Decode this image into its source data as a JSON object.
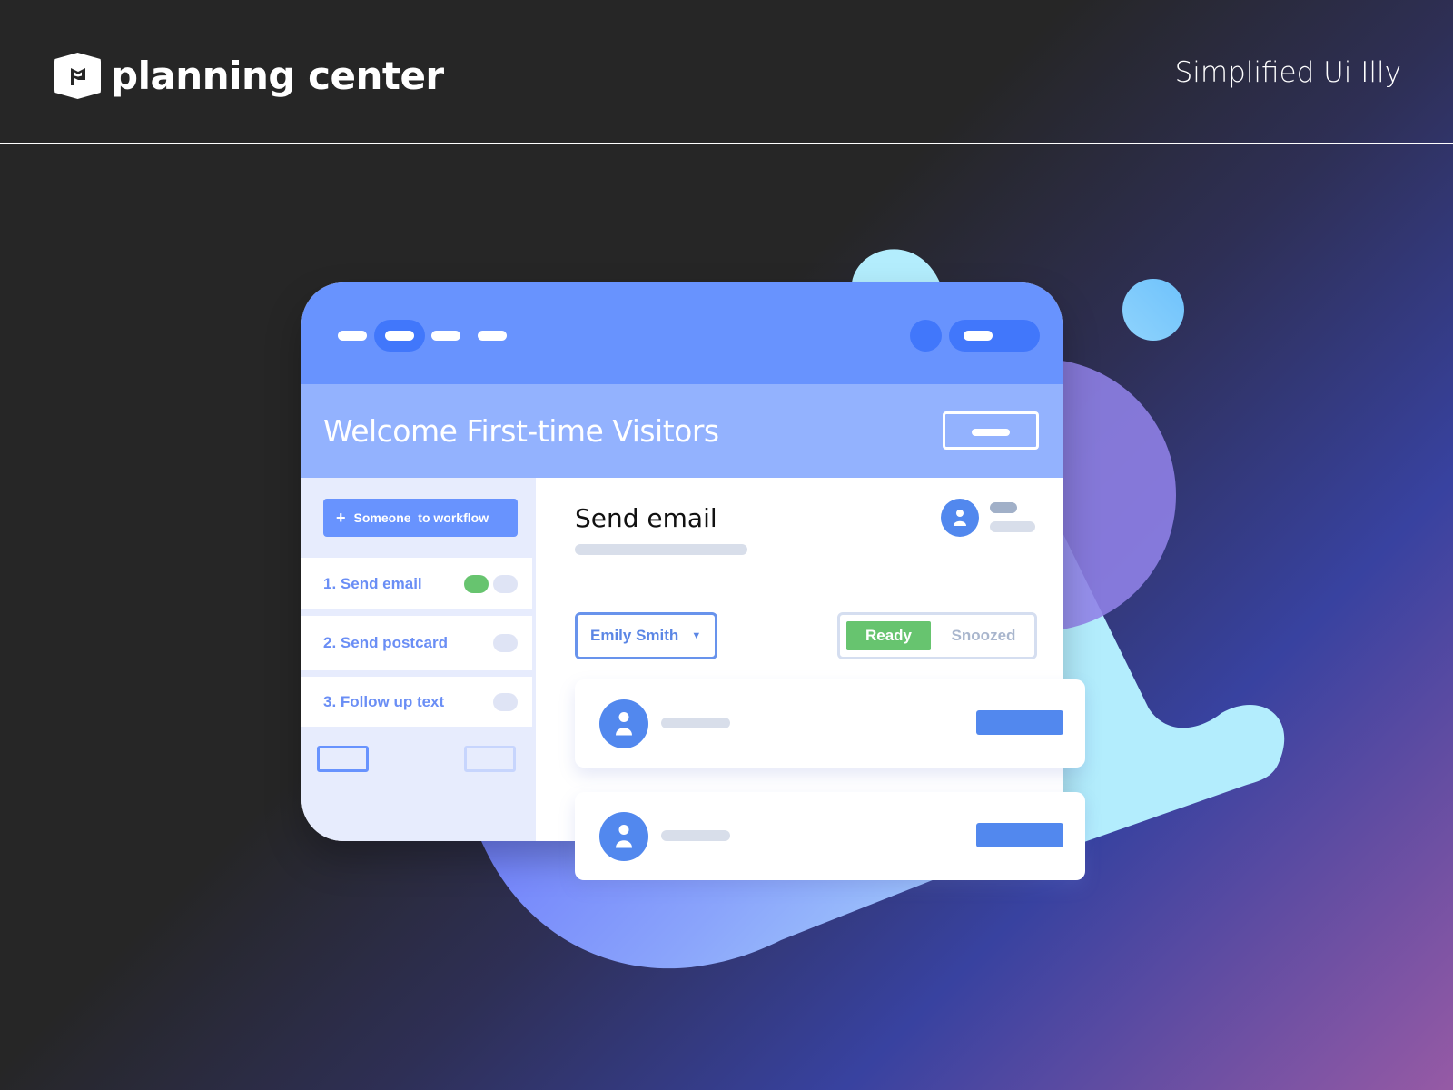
{
  "brand": {
    "name": "planning center",
    "logo_icon": "planning-center-flag-icon"
  },
  "page_label": "Simplified Ui Illy",
  "window": {
    "chrome": {
      "nav_items": 4,
      "active_nav_index": 1
    },
    "header": {
      "title": "Welcome First-time Visitors"
    },
    "sidebar": {
      "add_button_icon": "+",
      "add_button_label": "Someone  to workflow",
      "steps": [
        {
          "label": "1. Send email",
          "toggles": [
            "on",
            "off"
          ]
        },
        {
          "label": "2. Send postcard",
          "toggles": [
            "off"
          ]
        },
        {
          "label": "3. Follow up text",
          "toggles": [
            "off"
          ]
        }
      ]
    },
    "main": {
      "section_title": "Send email",
      "person_select": {
        "value": "Emily Smith",
        "caret": "▼"
      },
      "status_toggle": {
        "options": [
          "Ready",
          "Snoozed"
        ],
        "selected": "Ready"
      },
      "cards": [
        {
          "avatar_icon": "user-icon"
        },
        {
          "avatar_icon": "user-icon"
        }
      ]
    }
  },
  "colors": {
    "chrome": "#6893fe",
    "chrome_accent": "#4177fb",
    "header": "#93b2fe",
    "sidebar": "#e7ecfd",
    "step_text": "#6a8ef5",
    "ready_green": "#67c46f",
    "avatar_blue": "#5288ee",
    "placeholder_gray": "#d8deea"
  }
}
